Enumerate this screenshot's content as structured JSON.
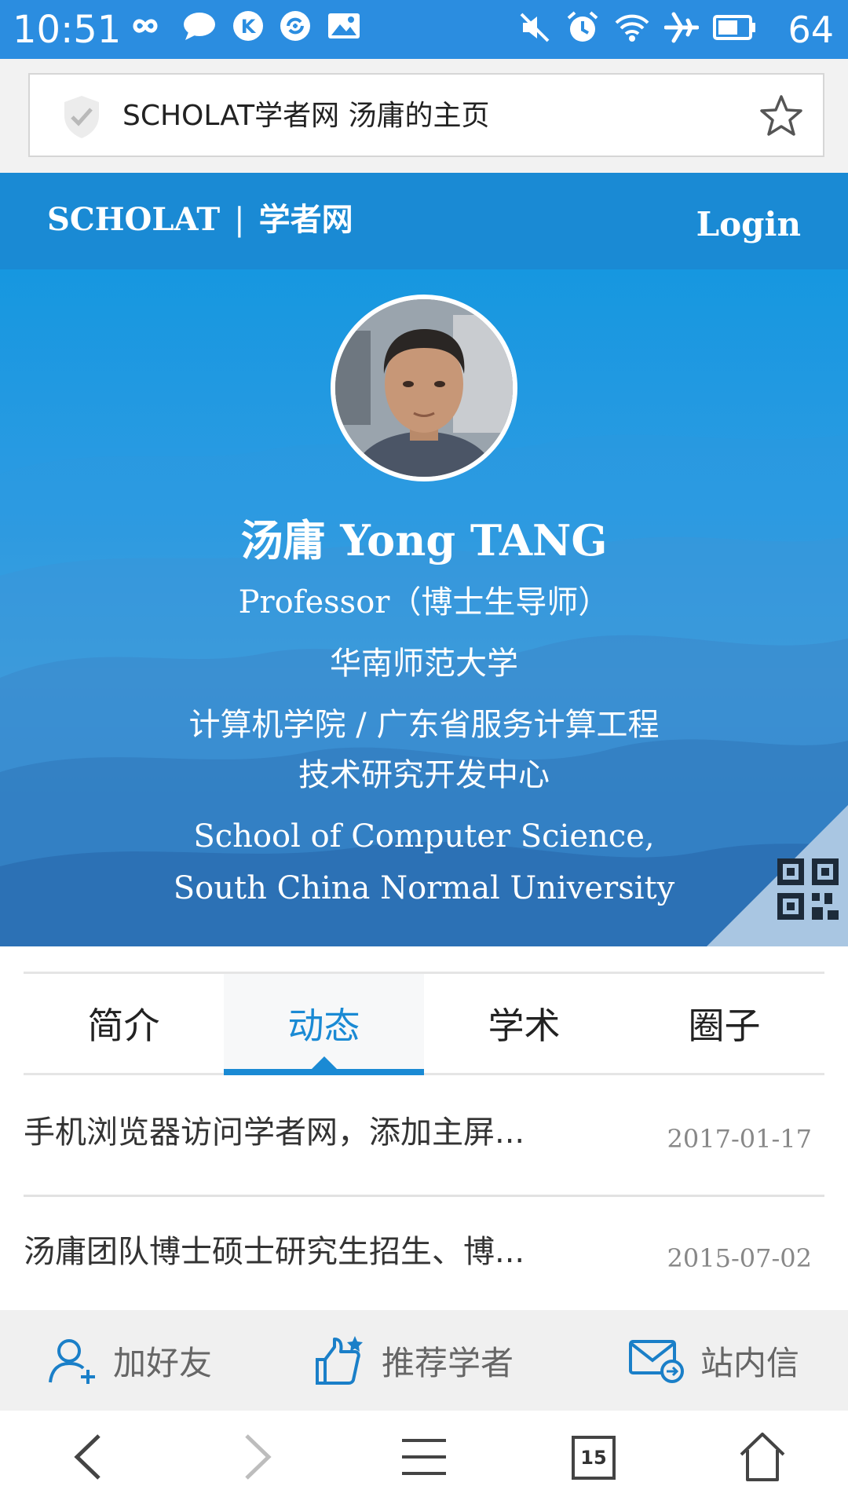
{
  "status_bar": {
    "time": "10:51",
    "battery": "64",
    "left_icons": [
      "infinity-icon",
      "chat-bubble-icon",
      "k-app-icon",
      "sync-icon",
      "image-icon"
    ],
    "right_icons": [
      "mute-icon",
      "alarm-icon",
      "wifi-icon",
      "airplane-icon",
      "battery-icon"
    ]
  },
  "address_bar": {
    "title": "SCHOLAT学者网 汤庸的主页"
  },
  "site_nav": {
    "brand_en": "SCHOLAT",
    "separator": "|",
    "brand_cn": "学者网",
    "login": "Login"
  },
  "profile": {
    "name": "汤庸 Yong TANG",
    "title": "Professor（博士生导师）",
    "university": "华南师范大学",
    "department_line1": "计算机学院 / 广东省服务计算工程",
    "department_line2": "技术研究开发中心",
    "school_en_line1": "School of Computer Science,",
    "school_en_line2": "South China Normal University"
  },
  "tabs": [
    {
      "label": "简介",
      "active": false
    },
    {
      "label": "动态",
      "active": true
    },
    {
      "label": "学术",
      "active": false
    },
    {
      "label": "圈子",
      "active": false
    }
  ],
  "news": [
    {
      "title": "手机浏览器访问学者网，添加主屏...",
      "date": "2017-01-17"
    },
    {
      "title": "汤庸团队博士硕士研究生招生、博...",
      "date": "2015-07-02"
    }
  ],
  "actions": {
    "add_friend": "加好友",
    "recommend": "推荐学者",
    "message": "站内信"
  },
  "browser": {
    "tab_count": "15"
  },
  "colors": {
    "status_bar": "#2b8de0",
    "brand_blue": "#1a8ad4",
    "action_icon_blue": "#1a7fc8"
  }
}
